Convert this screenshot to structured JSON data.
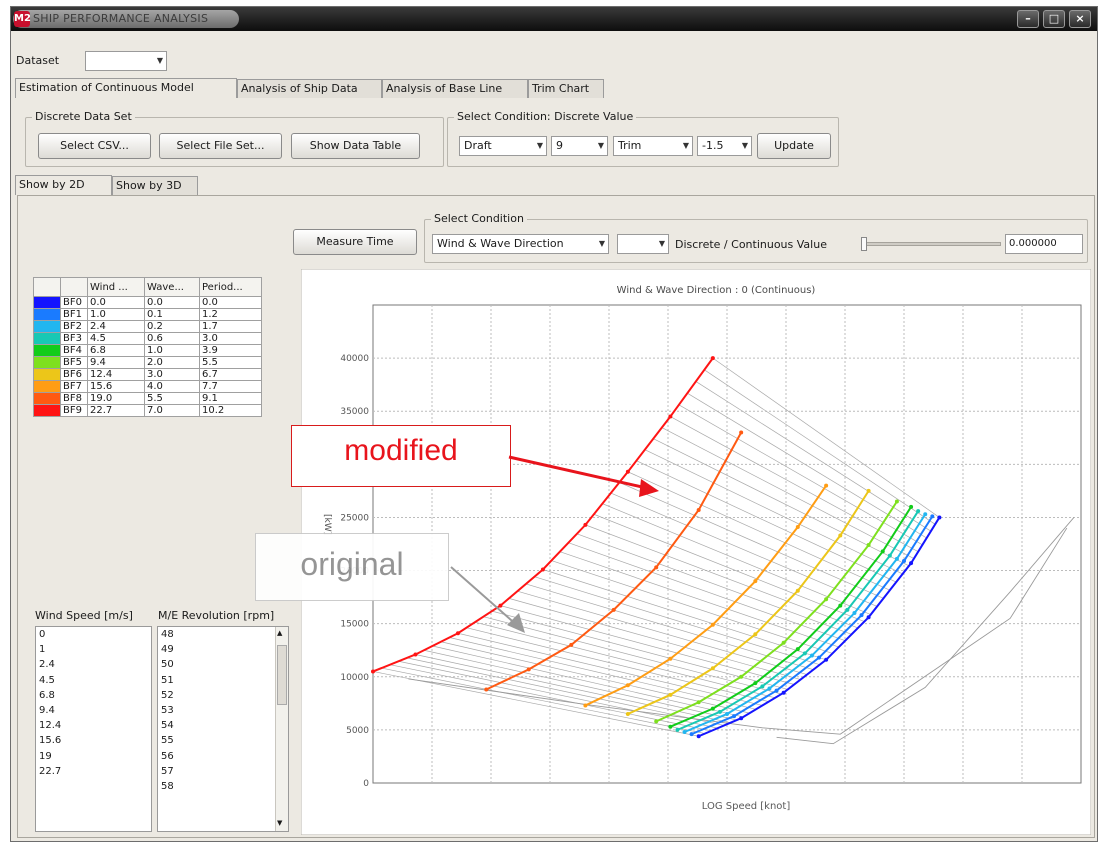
{
  "window": {
    "title": "SHIP PERFORMANCE ANALYSIS",
    "app_icon_text": "M2"
  },
  "dataset": {
    "label": "Dataset",
    "value": ""
  },
  "main_tabs": [
    "Estimation of Continuous Model",
    "Analysis of Ship Data",
    "Analysis of Base Line",
    "Trim Chart"
  ],
  "discrete_data_set": {
    "title": "Discrete Data Set",
    "buttons": [
      "Select CSV...",
      "Select File Set...",
      "Show Data Table"
    ]
  },
  "select_condition_discrete": {
    "title": "Select Condition: Discrete Value",
    "combo1": "Draft",
    "combo2": "9",
    "combo3": "Trim",
    "combo4": "-1.5",
    "update_label": "Update"
  },
  "view_tabs": [
    "Show by 2D",
    "Show by 3D"
  ],
  "measure_time_label": "Measure Time",
  "select_condition": {
    "title": "Select Condition",
    "direction": "Wind & Wave Direction",
    "second_combo": "",
    "slider_label": "Discrete / Continuous Value",
    "slider_value": 0.0,
    "spinner_value": "0.000000"
  },
  "bf_table": {
    "headers": [
      "",
      "",
      "Wind ...",
      "Wave...",
      "Period..."
    ],
    "rows": [
      {
        "name": "BF0",
        "wind": "0.0",
        "wave": "0.0",
        "period": "0.0",
        "color": "#1414ff"
      },
      {
        "name": "BF1",
        "wind": "1.0",
        "wave": "0.1",
        "period": "1.2",
        "color": "#1a7bff"
      },
      {
        "name": "BF2",
        "wind": "2.4",
        "wave": "0.2",
        "period": "1.7",
        "color": "#22b6f0"
      },
      {
        "name": "BF3",
        "wind": "4.5",
        "wave": "0.6",
        "period": "3.0",
        "color": "#18c8b4"
      },
      {
        "name": "BF4",
        "wind": "6.8",
        "wave": "1.0",
        "period": "3.9",
        "color": "#12cc1a"
      },
      {
        "name": "BF5",
        "wind": "9.4",
        "wave": "2.0",
        "period": "5.5",
        "color": "#7ee01e"
      },
      {
        "name": "BF6",
        "wind": "12.4",
        "wave": "3.0",
        "period": "6.7",
        "color": "#ecc619"
      },
      {
        "name": "BF7",
        "wind": "15.6",
        "wave": "4.0",
        "period": "7.7",
        "color": "#ff9d14"
      },
      {
        "name": "BF8",
        "wind": "19.0",
        "wave": "5.5",
        "period": "9.1",
        "color": "#ff5a12"
      },
      {
        "name": "BF9",
        "wind": "22.7",
        "wave": "7.0",
        "period": "10.2",
        "color": "#ff1414"
      }
    ]
  },
  "wind_list": {
    "header": "Wind Speed [m/s]",
    "items": [
      "0",
      "1",
      "2.4",
      "4.5",
      "6.8",
      "9.4",
      "12.4",
      "15.6",
      "19",
      "22.7"
    ]
  },
  "rpm_list": {
    "header": "M/E Revolution [rpm]",
    "items": [
      "48",
      "49",
      "50",
      "51",
      "52",
      "53",
      "54",
      "55",
      "56",
      "57",
      "58"
    ]
  },
  "annotations": {
    "modified": "modified",
    "original": "original",
    "modified_color": "#e8141c",
    "original_color": "#8d8d8d"
  },
  "chart_data": {
    "type": "line",
    "title": "Wind & Wave Direction : 0 (Continuous)",
    "xlabel": "LOG Speed [knot]",
    "ylabel": "[kW]",
    "ylim": [
      0,
      45000
    ],
    "yticks": [
      0,
      5000,
      10000,
      15000,
      20000,
      25000,
      30000,
      35000,
      40000
    ],
    "x_unit_note": "x values are relative positions along the unlabeled LOG speed axis (0-1)",
    "grid": true,
    "series": [
      {
        "name": "BF9",
        "color": "#ff1414",
        "x": [
          0.0,
          0.06,
          0.12,
          0.18,
          0.24,
          0.3,
          0.36,
          0.42,
          0.48
        ],
        "y": [
          10500,
          12100,
          14100,
          16700,
          20100,
          24300,
          29300,
          34500,
          40000
        ]
      },
      {
        "name": "BF8",
        "color": "#ff5a12",
        "x": [
          0.16,
          0.22,
          0.28,
          0.34,
          0.4,
          0.46,
          0.52
        ],
        "y": [
          8800,
          10700,
          13000,
          16300,
          20300,
          25700,
          33000
        ]
      },
      {
        "name": "BF7",
        "color": "#ff9d14",
        "x": [
          0.3,
          0.36,
          0.42,
          0.48,
          0.54,
          0.6,
          0.64
        ],
        "y": [
          7300,
          9200,
          11700,
          14900,
          19000,
          24100,
          28000
        ]
      },
      {
        "name": "BF6",
        "color": "#ecc619",
        "x": [
          0.36,
          0.42,
          0.48,
          0.54,
          0.6,
          0.66,
          0.7
        ],
        "y": [
          6500,
          8300,
          10800,
          14000,
          18100,
          23300,
          27500
        ]
      },
      {
        "name": "BF5",
        "color": "#7ee01e",
        "x": [
          0.4,
          0.46,
          0.52,
          0.58,
          0.64,
          0.7,
          0.74
        ],
        "y": [
          5800,
          7600,
          10000,
          13200,
          17300,
          22400,
          26500
        ]
      },
      {
        "name": "BF4",
        "color": "#12cc1a",
        "x": [
          0.42,
          0.48,
          0.54,
          0.6,
          0.66,
          0.72,
          0.76
        ],
        "y": [
          5300,
          7000,
          9400,
          12600,
          16700,
          21800,
          26000
        ]
      },
      {
        "name": "BF3",
        "color": "#18c8b4",
        "x": [
          0.43,
          0.49,
          0.55,
          0.61,
          0.67,
          0.73,
          0.77
        ],
        "y": [
          5000,
          6700,
          9100,
          12200,
          16300,
          21400,
          25600
        ]
      },
      {
        "name": "BF2",
        "color": "#22b6f0",
        "x": [
          0.44,
          0.5,
          0.56,
          0.62,
          0.68,
          0.74,
          0.78
        ],
        "y": [
          4800,
          6500,
          8900,
          12000,
          16000,
          21100,
          25300
        ]
      },
      {
        "name": "BF1",
        "color": "#1a7bff",
        "x": [
          0.45,
          0.51,
          0.57,
          0.63,
          0.69,
          0.75,
          0.79
        ],
        "y": [
          4600,
          6300,
          8700,
          11800,
          15800,
          20900,
          25100
        ]
      },
      {
        "name": "BF0",
        "color": "#1414ff",
        "x": [
          0.46,
          0.52,
          0.58,
          0.64,
          0.7,
          0.76,
          0.8
        ],
        "y": [
          4400,
          6100,
          8500,
          11600,
          15600,
          20700,
          25000
        ]
      }
    ]
  }
}
